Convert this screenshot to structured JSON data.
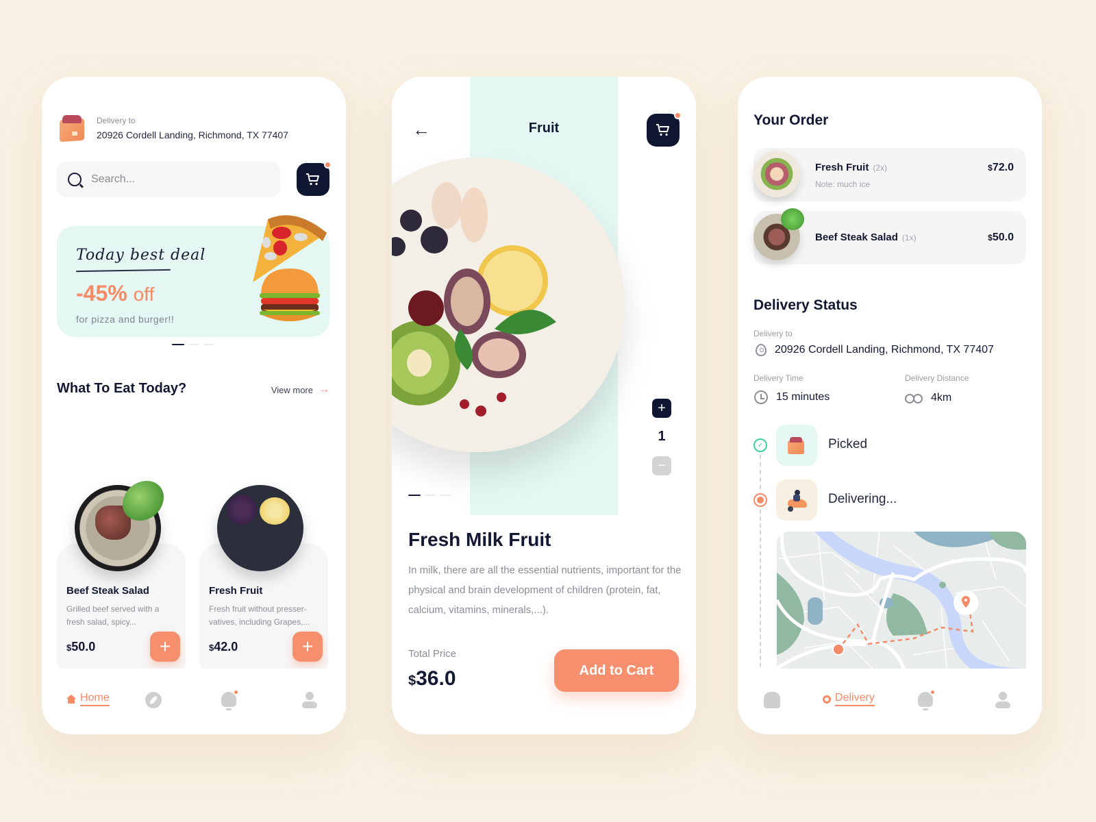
{
  "colors": {
    "background": "#f8f0e3",
    "accent": "#f58a66",
    "dark": "#121833",
    "mint": "#e4f7f2",
    "success": "#3ecf9c"
  },
  "home": {
    "delivery_label": "Delivery to",
    "delivery_address": "20926 Cordell Landing, Richmond, TX 77407",
    "search_placeholder": "Search...",
    "cart_icon": "cart-icon",
    "promo": {
      "title": "Today best deal",
      "discount": "-45%",
      "discount_suffix": "off",
      "subtitle": "for pizza and burger!!"
    },
    "carousel": {
      "pages": 3,
      "active": 1
    },
    "section_title": "What To Eat Today?",
    "view_more": "View more",
    "foods": [
      {
        "name": "Beef Steak Salad",
        "description": "Grilled beef served with a fresh salad, spicy...",
        "currency": "$",
        "price": "50.0"
      },
      {
        "name": "Fresh Fruit",
        "description": "Fresh fruit without presser-vatives, including Grapes,...",
        "currency": "$",
        "price": "42.0"
      }
    ],
    "tabbar": {
      "home_label": "Home",
      "active": "home"
    }
  },
  "detail": {
    "title": "Fruit",
    "back_icon": "arrow-left-icon",
    "quantity": "1",
    "carousel": {
      "pages": 3,
      "active": 1
    },
    "product_name": "Fresh Milk Fruit",
    "description": "In milk, there are all the essential nutrients, important for the physical and brain development of children (protein, fat, calcium, vitamins, minerals,...).",
    "total_label": "Total Price",
    "currency": "$",
    "total_price": "36.0",
    "add_to_cart": "Add to Cart"
  },
  "order": {
    "title": "Your Order",
    "items": [
      {
        "name": "Fresh Fruit",
        "qty": "(2x)",
        "note": "Note: much ice",
        "currency": "$",
        "price": "72.0"
      },
      {
        "name": "Beef Steak Salad",
        "qty": "(1x)",
        "note": "",
        "currency": "$",
        "price": "50.0"
      }
    ],
    "status_title": "Delivery Status",
    "delivery_to_label": "Delivery to",
    "delivery_address": "20926 Cordell Landing, Richmond, TX 77407",
    "time_label": "Delivery Time",
    "time_value": "15 minutes",
    "distance_label": "Delivery Distance",
    "distance_value": "4km",
    "steps": [
      {
        "label": "Picked",
        "state": "done"
      },
      {
        "label": "Delivering...",
        "state": "active"
      }
    ],
    "tabbar": {
      "delivery_label": "Delivery",
      "active": "delivery"
    }
  }
}
